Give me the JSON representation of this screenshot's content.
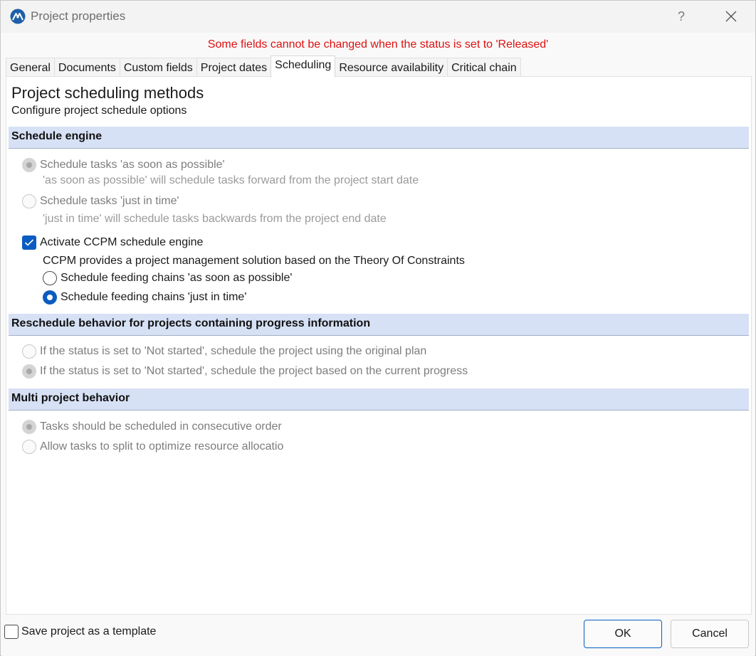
{
  "window": {
    "title": "Project properties",
    "help_label": "?",
    "close_icon": "close-icon",
    "app_icon": "app-logo-icon"
  },
  "warning": "Some fields cannot be changed when the status is set to 'Released'",
  "tabs": [
    {
      "label": "General",
      "active": false
    },
    {
      "label": "Documents",
      "active": false
    },
    {
      "label": "Custom fields",
      "active": false
    },
    {
      "label": "Project dates",
      "active": false
    },
    {
      "label": "Scheduling",
      "active": true
    },
    {
      "label": "Resource availability",
      "active": false
    },
    {
      "label": "Critical chain",
      "active": false
    }
  ],
  "page": {
    "heading": "Project scheduling methods",
    "subheading": "Configure project schedule options"
  },
  "schedule_engine": {
    "title": "Schedule engine",
    "asap": {
      "label": "Schedule tasks 'as soon as possible'",
      "selected": true,
      "enabled": false
    },
    "asap_desc": "'as soon as possible' will schedule tasks forward from the project start date",
    "jit": {
      "label": "Schedule tasks 'just in time'",
      "selected": false,
      "enabled": false
    },
    "jit_desc": "'just in time' will schedule tasks backwards from the project end date",
    "ccpm": {
      "label": "Activate CCPM schedule engine",
      "checked": true
    },
    "ccpm_desc": "CCPM provides a project management solution based on the Theory Of Constraints",
    "feeding_asap": {
      "label": "Schedule feeding chains 'as soon as possible'",
      "selected": false
    },
    "feeding_jit": {
      "label": "Schedule feeding chains 'just in time'",
      "selected": true
    }
  },
  "reschedule": {
    "title": "Reschedule behavior for projects containing progress information",
    "original": {
      "label": "If the status is set to 'Not started', schedule the project using the original plan",
      "selected": false
    },
    "current": {
      "label": "If the status is set to 'Not started', schedule the project based on the current progress",
      "selected": true
    }
  },
  "multi": {
    "title": "Multi project behavior",
    "consecutive": {
      "label": "Tasks should be scheduled in consecutive order",
      "selected": true
    },
    "split": {
      "label": "Allow tasks to split to optimize resource allocatio",
      "selected": false
    }
  },
  "footer": {
    "template_label": "Save project as a template",
    "template_checked": false,
    "ok_label": "OK",
    "cancel_label": "Cancel"
  },
  "colors": {
    "accent": "#0b5cc0",
    "warning": "#e01010",
    "section_bg": "#d6e1f5"
  }
}
